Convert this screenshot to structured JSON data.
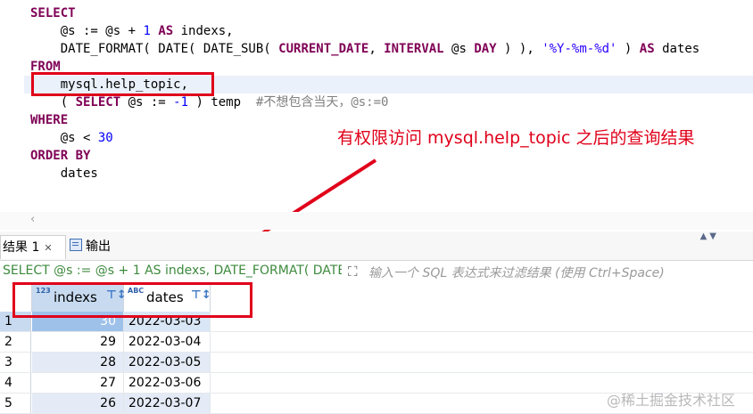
{
  "editor": {
    "lines": [
      [
        {
          "t": "SELECT",
          "c": "kw"
        }
      ],
      [
        {
          "t": "    @s := @s + ",
          "c": ""
        },
        {
          "t": "1",
          "c": "num"
        },
        {
          "t": " ",
          "c": ""
        },
        {
          "t": "AS",
          "c": "kw"
        },
        {
          "t": " indexs,",
          "c": ""
        }
      ],
      [
        {
          "t": "    DATE_FORMAT( DATE( DATE_SUB( ",
          "c": ""
        },
        {
          "t": "CURRENT_DATE",
          "c": "kw"
        },
        {
          "t": ", ",
          "c": ""
        },
        {
          "t": "INTERVAL",
          "c": "kw"
        },
        {
          "t": " @s ",
          "c": ""
        },
        {
          "t": "DAY",
          "c": "kw"
        },
        {
          "t": " ) ), ",
          "c": ""
        },
        {
          "t": "'%Y-%m-%d'",
          "c": "str"
        },
        {
          "t": " ) ",
          "c": ""
        },
        {
          "t": "AS",
          "c": "kw"
        },
        {
          "t": " dates",
          "c": ""
        }
      ],
      [
        {
          "t": "FROM",
          "c": "kw"
        }
      ],
      [
        {
          "t": "    mysql.help_topic,",
          "c": ""
        }
      ],
      [
        {
          "t": "    ( ",
          "c": ""
        },
        {
          "t": "SELECT",
          "c": "kw"
        },
        {
          "t": " @s := ",
          "c": ""
        },
        {
          "t": "-1",
          "c": "num"
        },
        {
          "t": " ) temp  ",
          "c": ""
        },
        {
          "t": "#不想包含当天，@s:=0",
          "c": "cmt"
        }
      ],
      [
        {
          "t": "WHERE",
          "c": "kw"
        }
      ],
      [
        {
          "t": "    @s < ",
          "c": ""
        },
        {
          "t": "30",
          "c": "num"
        }
      ],
      [
        {
          "t": "ORDER BY",
          "c": "kw"
        }
      ],
      [
        {
          "t": "    dates",
          "c": ""
        }
      ]
    ],
    "annotation": "有权限访问  mysql.help_topic 之后的查询结果",
    "scroll_left_icon": "chevron-left-icon"
  },
  "tabs": {
    "result_label": "结果 1",
    "close_icon": "close-icon",
    "output_label": "输出",
    "output_icon": "output-icon"
  },
  "filter": {
    "sql": "SELECT @s := @s + 1 AS indexs, DATE_FORMAT( DATE",
    "placeholder": "输入一个 SQL 表达式来过滤结果 (使用 Ctrl+Space)"
  },
  "grid": {
    "columns": [
      {
        "type_badge": "123",
        "name": "indexs",
        "sort_icon": "filter-sort-icon"
      },
      {
        "type_badge": "ABC",
        "name": "dates",
        "sort_icon": "filter-sort-icon"
      }
    ],
    "rows": [
      {
        "num": "1",
        "indexs": "30",
        "dates": "2022-03-03"
      },
      {
        "num": "2",
        "indexs": "29",
        "dates": "2022-03-04"
      },
      {
        "num": "3",
        "indexs": "28",
        "dates": "2022-03-05"
      },
      {
        "num": "4",
        "indexs": "27",
        "dates": "2022-03-06"
      },
      {
        "num": "5",
        "indexs": "26",
        "dates": "2022-03-07"
      }
    ]
  },
  "watermark": "@稀土掘金技术社区",
  "colors": {
    "annotation_red": "#e0001a",
    "keyword": "#7f0055",
    "number": "#0000ff",
    "selection": "#9ec1ea"
  }
}
